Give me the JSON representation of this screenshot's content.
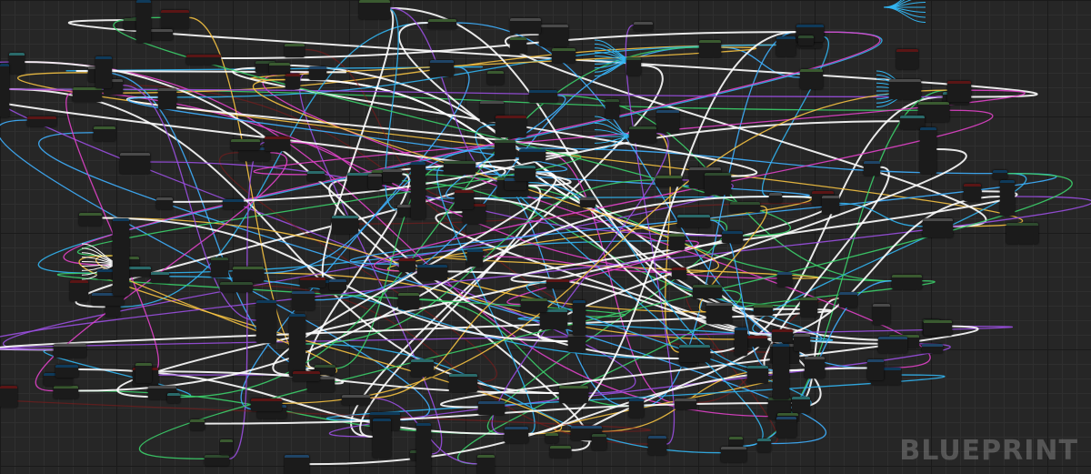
{
  "editor": {
    "watermark": "BLUEPRINT"
  },
  "colors": {
    "background": "#262626",
    "grid_major": "#1a1a1a",
    "grid_minor": "#2f2f2f",
    "node_body": "#1b1b1b",
    "header_event": "#5a1515",
    "header_function": "#1f4466",
    "header_pure": "#3a5a30",
    "header_macro": "#4a4a4a",
    "header_variable": "#2e4a2e",
    "header_cast": "#2a6a6a",
    "header_struct": "#0f3a5a",
    "wire_exec": "#ffffff",
    "wire_float": "#32b4f0",
    "wire_bool": "#8b1a1a",
    "wire_object": "#3fb0ff",
    "wire_vector": "#f5c242",
    "wire_int": "#3ccf6a",
    "wire_struct": "#9a4fe0",
    "wire_string": "#e043c8"
  }
}
